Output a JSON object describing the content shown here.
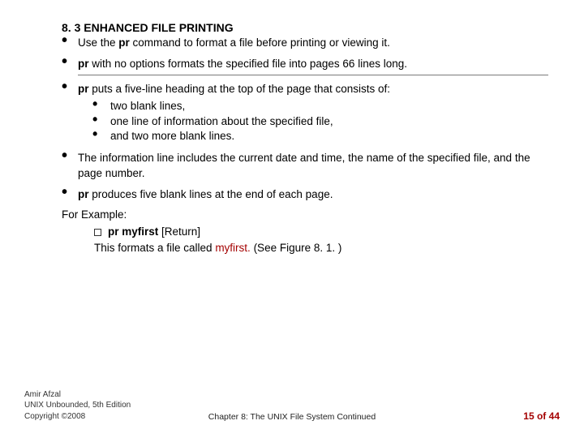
{
  "heading": "8. 3 ENHANCED FILE PRINTING",
  "bullets": {
    "b1_a": "Use the ",
    "b1_cmd": "pr",
    "b1_b": " command to format a file before printing or viewing it.",
    "b2_cmd": "pr",
    "b2_rest": " with no options formats the specified file into pages 66 lines long.",
    "b3_cmd": "pr",
    "b3_rest": " puts a five-line heading at the top of the page that consists of:",
    "b3_sub1": "two blank lines,",
    "b3_sub2": "one line of information about the specified file,",
    "b3_sub3": "and two more blank lines.",
    "b4": "The information line includes the current date and time, the name of the specified file, and the page number.",
    "b5_cmd": "pr",
    "b5_rest": " produces five blank lines at the end of each page."
  },
  "for_example": "For Example:",
  "example": {
    "cmd_bold": "pr myfirst",
    "cmd_tail": " [Return]",
    "line2_a": "This formats a file called ",
    "line2_red": "myfirst.",
    "line2_b": " (See Figure 8. 1. )"
  },
  "footer": {
    "author": "Amir Afzal",
    "book": "UNIX Unbounded, 5th Edition",
    "copyright": "Copyright ©2008",
    "chapter": "Chapter 8: The UNIX File System Continued",
    "page_a": "15",
    "page_of": " of ",
    "page_b": "44"
  }
}
